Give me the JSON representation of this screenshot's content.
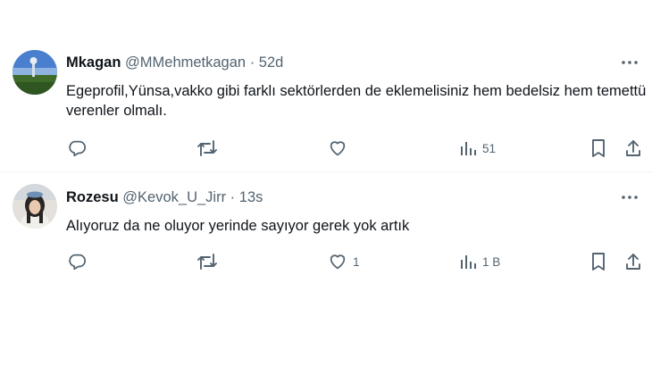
{
  "tweets": [
    {
      "display_name": "Mkagan",
      "handle": "@MMehmetkagan",
      "separator": "·",
      "time": "52d",
      "text": "Egeprofil,Yünsa,vakko gibi farklı sektörlerden de eklemelisiniz hem bedelsiz hem temettü verenler olmalı.",
      "replies": "",
      "reposts": "",
      "likes": "",
      "views": "51"
    },
    {
      "display_name": "Rozesu",
      "handle": "@Kevok_U_Jirr",
      "separator": "·",
      "time": "13s",
      "text": "Alıyoruz da ne oluyor yerinde sayıyor gerek yok artık",
      "replies": "",
      "reposts": "",
      "likes": "1",
      "views": "1 B"
    }
  ],
  "colors": {
    "text_primary": "#0f1419",
    "text_secondary": "#536471",
    "divider": "#eff3f4"
  },
  "icons": [
    "more-icon",
    "reply-icon",
    "repost-icon",
    "like-icon",
    "views-icon",
    "bookmark-icon",
    "share-icon"
  ]
}
